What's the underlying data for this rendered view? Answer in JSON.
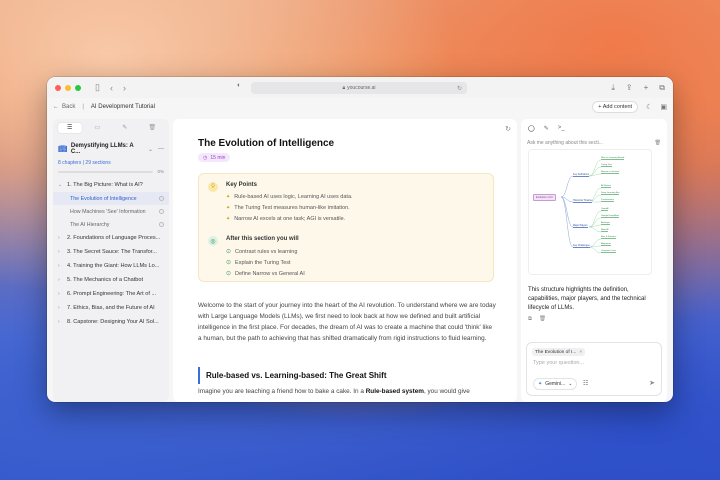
{
  "browser": {
    "url": "youcourse.ai"
  },
  "app": {
    "back_label": "Back",
    "breadcrumb": "AI Development Tutorial",
    "add_content_label": "+ Add content"
  },
  "sidebar": {
    "course_title": "Demystifying LLMs: A C...",
    "meta": "8 chapters | 29 sections",
    "progress_text": "0%",
    "progress": 0,
    "chapters": [
      {
        "label": "1. The Big Picture: What is AI?",
        "chev": "⌄"
      },
      {
        "label": "2. Foundations of Language Proces...",
        "chev": "›"
      },
      {
        "label": "3. The Secret Sauce: The Transfor...",
        "chev": "›"
      },
      {
        "label": "4. Training the Giant: How LLMs Lo...",
        "chev": "›"
      },
      {
        "label": "5. The Mechanics of a Chatbot",
        "chev": "›"
      },
      {
        "label": "6. Prompt Engineering: The Art of ...",
        "chev": "›"
      },
      {
        "label": "7. Ethics, Bias, and the Future of AI",
        "chev": "›"
      },
      {
        "label": "8. Capstone: Designing Your AI Sol...",
        "chev": "›"
      }
    ],
    "sections": [
      {
        "label": "The Evolution of Intelligence"
      },
      {
        "label": "How Machines 'See' Information"
      },
      {
        "label": "The AI Hierarchy"
      }
    ]
  },
  "main": {
    "title": "The Evolution of Intelligence",
    "duration": "15 min",
    "key_points_title": "Key Points",
    "key_points": [
      "Rule-based AI uses logic, Learning AI uses data.",
      "The Turing Test measures human-like imitation.",
      "Narrow AI excels at one task; AGI is versatile."
    ],
    "goals_title": "After this section you will",
    "goals": [
      "Contrast rules vs learning",
      "Explain the Turing Test",
      "Define Narrow vs General AI"
    ],
    "intro_paragraph": "Welcome to the start of your journey into the heart of the AI revolution. To understand where we are today with Large Language Models (LLMs), we first need to look back at how we defined and built artificial intelligence in the first place. For decades, the dream of AI was to create a machine that could 'think' like a human, but the path to achieving that has shifted dramatically from rigid instructions to fluid learning.",
    "section_heading": "Rule-based vs. Learning-based: The Great Shift",
    "p2_before": "Imagine you are teaching a friend how to bake a cake. In a ",
    "p2_bold": "Rule-based system",
    "p2_after": ", you would give"
  },
  "panel": {
    "ask_placeholder": "Ask me anything about this secti...",
    "mindmap": {
      "root": "Evolution of AI",
      "branches": [
        {
          "label": "Key Definitions",
          "children": [
            "Rule vs Learning Based",
            "Turing Test",
            "Narrow vs General"
          ]
        },
        {
          "label": "Historical Timeline",
          "children": [
            "AI Winters",
            "Deep Learning Era",
            "Transformers"
          ]
        },
        {
          "label": "Major Players",
          "children": [
            "OpenAI",
            "Google DeepMind",
            "Anthropic",
            "Meta AI"
          ]
        },
        {
          "label": "Key Challenges",
          "children": [
            "Bias & Fairness",
            "Alignment",
            "Compute Costs"
          ]
        }
      ]
    },
    "summary": "This structure highlights the definition, capabilities, major players, and the technical lifecycle of LLMs.",
    "context_chip": "The Evolution of I...",
    "question_placeholder": "Type your question...",
    "model_label": "Gemini..."
  }
}
